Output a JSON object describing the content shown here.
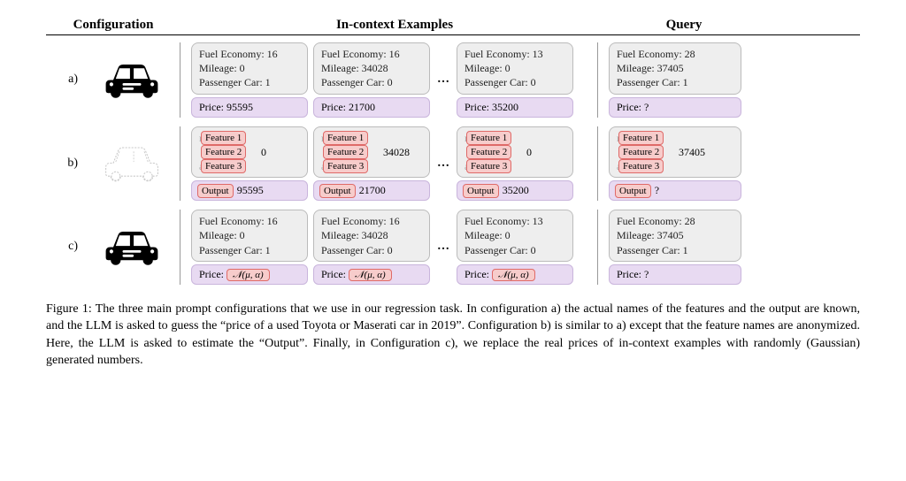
{
  "headers": {
    "config": "Configuration",
    "incontext": "In-context Examples",
    "query": "Query"
  },
  "row_labels": {
    "a": "a)",
    "b": "b)",
    "c": "c)"
  },
  "feature_labels": {
    "named": {
      "f1": "Fuel Economy",
      "f2": "Mileage",
      "f3": "Passenger Car"
    },
    "anon": {
      "f1": "Feature 1",
      "f2": "Feature 2",
      "f3": "Feature 3"
    }
  },
  "output_label": {
    "named": "Price",
    "anon": "Output"
  },
  "data_cols": {
    "ex1": {
      "f1": "16",
      "f2": "0",
      "f3": "1",
      "price": "95595"
    },
    "ex2": {
      "f1": "16",
      "f2": "34028",
      "f3": "0",
      "price": "21700"
    },
    "ex3": {
      "f1": "13",
      "f2": "0",
      "f3": "0",
      "price": "35200"
    },
    "q": {
      "f1": "28",
      "f2": "37405",
      "f3": "1",
      "price": "?"
    }
  },
  "ellipsis": "…",
  "rand_price": "𝒩(μ, α)",
  "caption": "Figure 1: The three main prompt configurations that we use in our regression task. In configuration a) the actual names of the features and the output are known, and the LLM is asked to guess the “price of a used Toyota or Maserati car in 2019”. Configuration b) is similar to a) except that the feature names are anonymized. Here, the LLM is asked to estimate the “Output”. Finally, in Configuration c), we replace the real prices of in-context examples with randomly (Gaussian) generated numbers."
}
